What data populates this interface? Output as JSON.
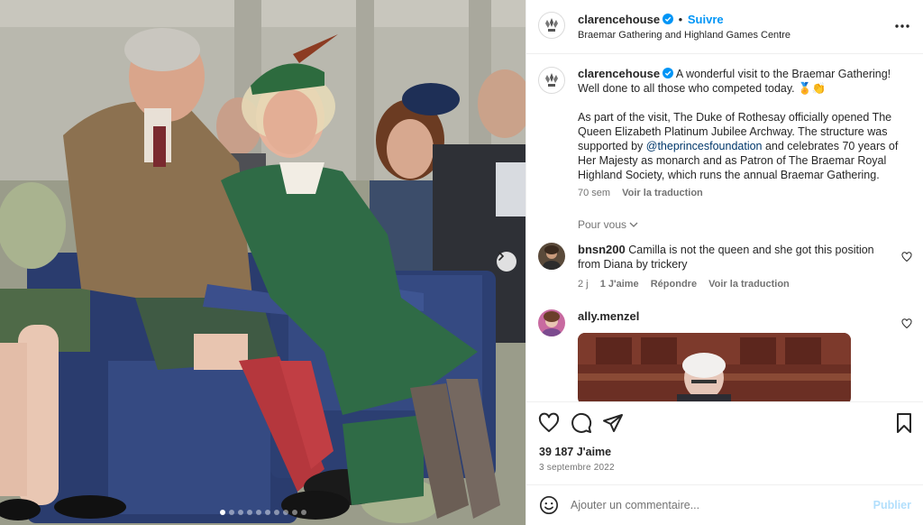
{
  "post": {
    "username": "clarencehouse",
    "follow_label": "Suivre",
    "separator": "•",
    "location": "Braemar Gathering and Highland Games Centre",
    "caption_username": "clarencehouse",
    "caption_line1": "A wonderful visit to the Braemar Gathering! Well done to all those who competed today. 🏅👏",
    "caption_p2_before": "As part of the visit, The Duke of Rothesay officially opened The Queen Elizabeth Platinum Jubilee Archway. The structure was supported by ",
    "caption_mention": "@theprincesfoundation",
    "caption_p2_after": " and celebrates 70 years of Her Majesty as monarch and as Patron of The Braemar Royal Highland Society, which runs the annual Braemar Gathering.",
    "age": "70 sem",
    "see_translation": "Voir la traduction",
    "for_you_label": "Pour vous"
  },
  "comments": [
    {
      "username": "bnsn200",
      "text": "Camilla is not the queen and she got this position from Diana by trickery",
      "age": "2 j",
      "likes": "1 J'aime",
      "reply": "Répondre",
      "translate": "Voir la traduction"
    },
    {
      "username": "ally.menzel",
      "text": ""
    }
  ],
  "actions": {
    "likes": "39 187 J'aime",
    "date": "3 septembre 2022"
  },
  "composer": {
    "placeholder": "Ajouter un commentaire...",
    "publish": "Publier"
  },
  "carousel": {
    "dot_count": 10,
    "active_index": 0
  },
  "colors": {
    "accent": "#0095f6",
    "text": "#262626",
    "secondary": "#737373",
    "mention": "#00376b",
    "publish_disabled": "#b2dffc"
  },
  "icons": [
    "more-icon",
    "verified-icon",
    "heart-icon",
    "comment-icon",
    "share-icon",
    "bookmark-icon",
    "emoji-icon",
    "chevron-right-icon",
    "chevron-down-icon"
  ]
}
